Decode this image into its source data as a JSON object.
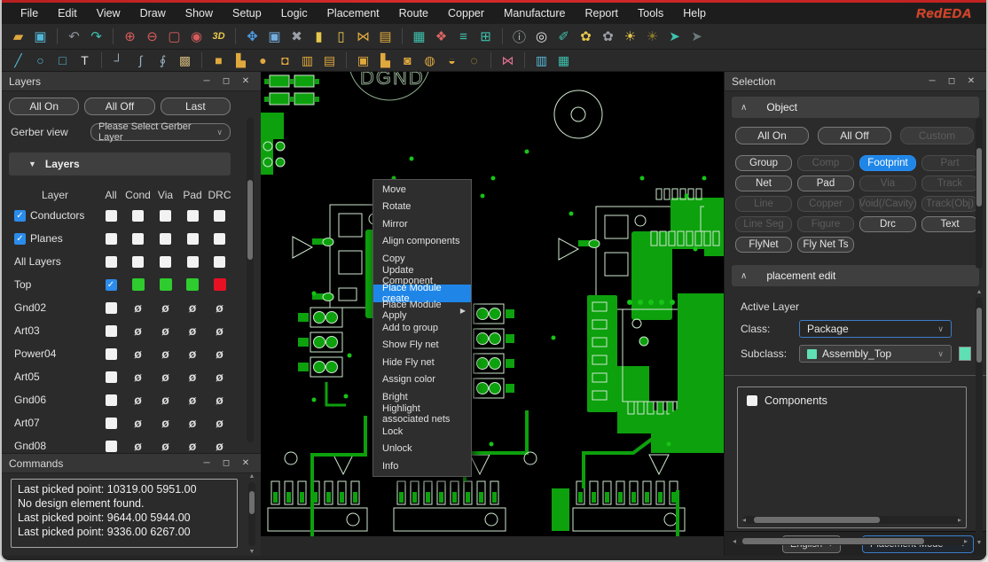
{
  "window": {
    "logo": "RedEDA"
  },
  "menubar": {
    "items": [
      "File",
      "Edit",
      "View",
      "Draw",
      "Show",
      "Setup",
      "Logic",
      "Placement",
      "Route",
      "Copper",
      "Manufacture",
      "Report",
      "Tools",
      "Help"
    ]
  },
  "toolbar_main": {
    "items": [
      {
        "name": "open-folder-icon",
        "glyph": "▰",
        "color": "#e0a93e"
      },
      {
        "name": "save-icon",
        "glyph": "▣",
        "color": "#52b7d8"
      },
      {
        "sep": true
      },
      {
        "name": "undo-icon",
        "glyph": "↶",
        "color": "#8a9097"
      },
      {
        "name": "redo-icon",
        "glyph": "↷",
        "color": "#3fc1ad"
      },
      {
        "sep": true
      },
      {
        "name": "zoom-in-icon",
        "glyph": "⊕",
        "color": "#d85c5c"
      },
      {
        "name": "zoom-out-icon",
        "glyph": "⊖",
        "color": "#d85c5c"
      },
      {
        "name": "zoom-fit-icon",
        "glyph": "▢",
        "color": "#d85c5c"
      },
      {
        "name": "zoom-selected-icon",
        "glyph": "◉",
        "color": "#d85c5c"
      },
      {
        "name": "view-3d-icon",
        "glyph": "3D",
        "color": "#e8c84c"
      },
      {
        "sep": true
      },
      {
        "name": "move-icon",
        "glyph": "✥",
        "color": "#4d9fe8"
      },
      {
        "name": "copy-icon",
        "glyph": "▣",
        "color": "#74aee0"
      },
      {
        "name": "delete-icon",
        "glyph": "✖",
        "color": "#9aa0a6"
      },
      {
        "name": "lock-icon",
        "glyph": "▮",
        "color": "#e8c84c"
      },
      {
        "name": "unlock-icon",
        "glyph": "▯",
        "color": "#e8c84c"
      },
      {
        "name": "sieve-icon",
        "glyph": "⋈",
        "color": "#e0a93e"
      },
      {
        "name": "sheet-icon",
        "glyph": "▤",
        "color": "#e0a93e"
      },
      {
        "sep": true
      },
      {
        "name": "grid-icon",
        "glyph": "▦",
        "color": "#3fc1ad"
      },
      {
        "name": "color-mix-icon",
        "glyph": "❖",
        "color": "#e06666"
      },
      {
        "name": "layers-icon",
        "glyph": "≡",
        "color": "#3fc1ad"
      },
      {
        "name": "panels-icon",
        "glyph": "⊞",
        "color": "#3fc1ad"
      },
      {
        "sep": true
      },
      {
        "name": "info-icon",
        "glyph": "ⓘ",
        "color": "#b0b5ba"
      },
      {
        "name": "search-icon",
        "glyph": "◎",
        "color": "#e8e8e8"
      },
      {
        "name": "measure-icon",
        "glyph": "✐",
        "color": "#3fc1ad"
      },
      {
        "name": "palette-icon",
        "glyph": "✿",
        "color": "#e8c84c"
      },
      {
        "name": "palette-alt-icon",
        "glyph": "✿",
        "color": "#9aa0a6"
      },
      {
        "name": "brightness-icon",
        "glyph": "☀",
        "color": "#e8c84c"
      },
      {
        "name": "brightness-off-icon",
        "glyph": "☀",
        "color": "#8a7b2a"
      },
      {
        "name": "flynet-show-icon",
        "glyph": "➤",
        "color": "#3fc1ad"
      },
      {
        "name": "flynet-hide-icon",
        "glyph": "➤",
        "color": "#6a7a7a"
      }
    ]
  },
  "toolbar_draw": {
    "items": [
      {
        "name": "line-tool-icon",
        "glyph": "╱",
        "color": "#58b8d8"
      },
      {
        "name": "ellipse-tool-icon",
        "glyph": "○",
        "color": "#58b8d8"
      },
      {
        "name": "rect-tool-icon",
        "glyph": "□",
        "color": "#58b8d8"
      },
      {
        "name": "text-tool-icon",
        "glyph": "T",
        "color": "#e0e0e0"
      },
      {
        "sep": true
      },
      {
        "name": "corner-tool-icon",
        "glyph": "┘",
        "color": "#9ab0c0"
      },
      {
        "name": "curve-tool-icon",
        "glyph": "∫",
        "color": "#9ab0c0"
      },
      {
        "name": "s-curve-tool-icon",
        "glyph": "∮",
        "color": "#9ab0c0"
      },
      {
        "name": "mesh-tool-icon",
        "glyph": "▩",
        "color": "#c8b078"
      },
      {
        "sep": true
      },
      {
        "name": "shape-rect-icon",
        "glyph": "■",
        "color": "#e0a93e"
      },
      {
        "name": "shape-l-icon",
        "glyph": "▙",
        "color": "#e0a93e"
      },
      {
        "name": "shape-circle-icon",
        "glyph": "●",
        "color": "#e0a93e"
      },
      {
        "name": "shape-pick-icon",
        "glyph": "◘",
        "color": "#e0a93e"
      },
      {
        "name": "shape-stack-icon",
        "glyph": "▥",
        "color": "#e0a93e"
      },
      {
        "name": "shape-sheet-icon",
        "glyph": "▤",
        "color": "#e0a93e"
      },
      {
        "sep": true
      },
      {
        "name": "pad-rect-icon",
        "glyph": "▣",
        "color": "#e0a93e"
      },
      {
        "name": "pad-l-icon",
        "glyph": "▙",
        "color": "#e0a93e"
      },
      {
        "name": "pad-round-icon",
        "glyph": "◙",
        "color": "#e0a93e"
      },
      {
        "name": "pad-dot-icon",
        "glyph": "◍",
        "color": "#e0a93e"
      },
      {
        "name": "pad-two-icon",
        "glyph": "◒",
        "color": "#e0a93e"
      },
      {
        "name": "pad-multi-icon",
        "glyph": "◌",
        "color": "#e0a93e"
      },
      {
        "sep": true
      },
      {
        "name": "mirror-icon",
        "glyph": "⋈",
        "color": "#e07090"
      },
      {
        "sep": true
      },
      {
        "name": "chart-icon",
        "glyph": "▥",
        "color": "#58b8d8"
      },
      {
        "name": "module-icon",
        "glyph": "▦",
        "color": "#3fc1ad"
      }
    ]
  },
  "layers_panel": {
    "title": "Layers",
    "buttons": [
      "All On",
      "All Off",
      "Last"
    ],
    "gerber_label": "Gerber view",
    "gerber_placeholder": "Please Select Gerber Layer",
    "section": "Layers",
    "columns": [
      "Layer",
      "All",
      "Cond",
      "Via",
      "Pad",
      "DRC"
    ],
    "rows": [
      {
        "lead_check": true,
        "name": "Conductors",
        "cells": [
          "cb",
          "cb",
          "cb",
          "cb",
          "cb"
        ]
      },
      {
        "lead_check": true,
        "name": "Planes",
        "cells": [
          "cb",
          "cb",
          "cb",
          "cb",
          "cb"
        ]
      },
      {
        "lead_check": false,
        "name": "All Layers",
        "cells": [
          "cb",
          "cb",
          "cb",
          "cb",
          "cb"
        ]
      },
      {
        "lead_check": false,
        "name": "Top",
        "cells": [
          "cbc",
          "green",
          "green",
          "green",
          "red"
        ]
      },
      {
        "lead_check": false,
        "name": "Gnd02",
        "cells": [
          "cb",
          "eye",
          "eye",
          "eye",
          "eye"
        ]
      },
      {
        "lead_check": false,
        "name": "Art03",
        "cells": [
          "cb",
          "eye",
          "eye",
          "eye",
          "eye"
        ]
      },
      {
        "lead_check": false,
        "name": "Power04",
        "cells": [
          "cb",
          "eye",
          "eye",
          "eye",
          "eye"
        ]
      },
      {
        "lead_check": false,
        "name": "Art05",
        "cells": [
          "cb",
          "eye",
          "eye",
          "eye",
          "eye"
        ]
      },
      {
        "lead_check": false,
        "name": "Gnd06",
        "cells": [
          "cb",
          "eye",
          "eye",
          "eye",
          "eye"
        ]
      },
      {
        "lead_check": false,
        "name": "Art07",
        "cells": [
          "cb",
          "eye",
          "eye",
          "eye",
          "eye"
        ]
      },
      {
        "lead_check": false,
        "name": "Gnd08",
        "cells": [
          "cb",
          "eye",
          "eye",
          "eye",
          "eye"
        ]
      }
    ]
  },
  "commands_panel": {
    "title": "Commands",
    "lines": [
      "Last picked point: 10319.00 5951.00",
      "No design element found.",
      "Last picked point: 9644.00 5944.00",
      "Last picked point: 9336.00 6267.00"
    ]
  },
  "context_menu": {
    "items": [
      {
        "label": "Move"
      },
      {
        "label": "Rotate"
      },
      {
        "label": "Mirror"
      },
      {
        "label": "Align components"
      },
      {
        "label": "Copy"
      },
      {
        "label": "Update Component"
      },
      {
        "label": "Place Module create",
        "highlighted": true
      },
      {
        "label": "Place Module Apply",
        "submenu": true
      },
      {
        "label": "Add to group"
      },
      {
        "label": "Show Fly net"
      },
      {
        "label": "Hide Fly net"
      },
      {
        "label": "Assign color"
      },
      {
        "label": "Bright"
      },
      {
        "label": "Highlight associated nets"
      },
      {
        "label": "Lock"
      },
      {
        "label": "Unlock"
      },
      {
        "label": "Info"
      }
    ]
  },
  "selection_panel": {
    "title": "Selection",
    "object_section": "Object",
    "top_buttons": [
      {
        "label": "All On",
        "state": "on"
      },
      {
        "label": "All Off",
        "state": "on"
      },
      {
        "label": "Custom",
        "state": "dim"
      }
    ],
    "filter_buttons": [
      {
        "label": "Group",
        "state": "on"
      },
      {
        "label": "Comp",
        "state": "dim"
      },
      {
        "label": "Footprint",
        "state": "active"
      },
      {
        "label": "Part",
        "state": "dim"
      },
      {
        "label": "Net",
        "state": "on"
      },
      {
        "label": "Pad",
        "state": "on"
      },
      {
        "label": "Via",
        "state": "dim"
      },
      {
        "label": "Track",
        "state": "dim"
      },
      {
        "label": "Line",
        "state": "dim"
      },
      {
        "label": "Copper",
        "state": "dim"
      },
      {
        "label": "Void(/Cavity)",
        "state": "dim"
      },
      {
        "label": "Track(Obj)",
        "state": "dim"
      },
      {
        "label": "Line Seg",
        "state": "dim"
      },
      {
        "label": "Figure",
        "state": "dim"
      },
      {
        "label": "Drc",
        "state": "on"
      },
      {
        "label": "Text",
        "state": "on"
      },
      {
        "label": "FlyNet",
        "state": "on"
      },
      {
        "label": "Fly Net Ts",
        "state": "on"
      }
    ],
    "placement_section": "placement edit",
    "active_layer_label": "Active Layer",
    "class_label": "Class:",
    "class_value": "Package",
    "subclass_label": "Subclass:",
    "subclass_value": "Assembly_Top",
    "components_label": "Components"
  },
  "statusbar": {
    "language": "English",
    "mode": "Placement Mode"
  },
  "canvas": {
    "net_label": "DGND"
  },
  "colors": {
    "accent": "#1f86e8",
    "layer_on_green": "#2ecc2e",
    "layer_drc_red": "#e81123",
    "subclass_swatch": "#5fe0b4",
    "pcb_copper_green": "#0da10d"
  }
}
